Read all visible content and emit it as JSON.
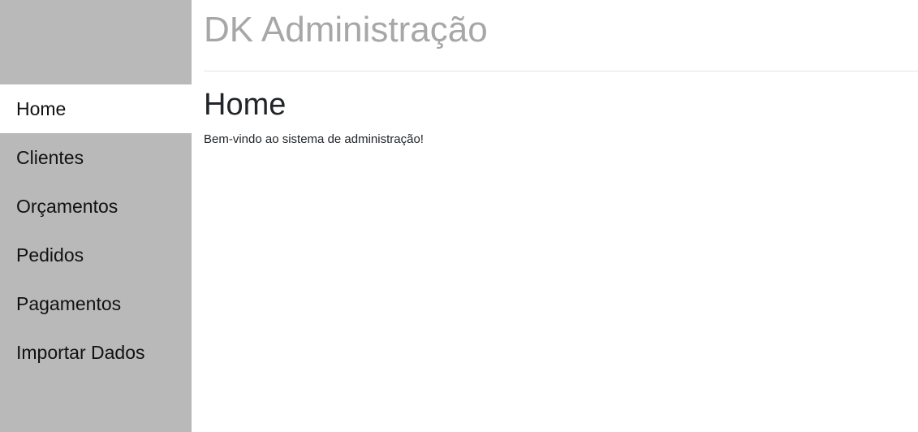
{
  "app": {
    "title": "DK Administração"
  },
  "sidebar": {
    "active_index": 0,
    "items": [
      {
        "label": "Home"
      },
      {
        "label": "Clientes"
      },
      {
        "label": "Orçamentos"
      },
      {
        "label": "Pedidos"
      },
      {
        "label": "Pagamentos"
      },
      {
        "label": "Importar Dados"
      }
    ]
  },
  "main": {
    "page_title": "Home",
    "welcome_text": "Bem-vindo ao sistema de administração!"
  },
  "colors": {
    "sidebar_background": "#b9b9b9",
    "active_item_background": "#ffffff",
    "app_title_color": "#a7a7a7",
    "text_color": "#212529"
  }
}
